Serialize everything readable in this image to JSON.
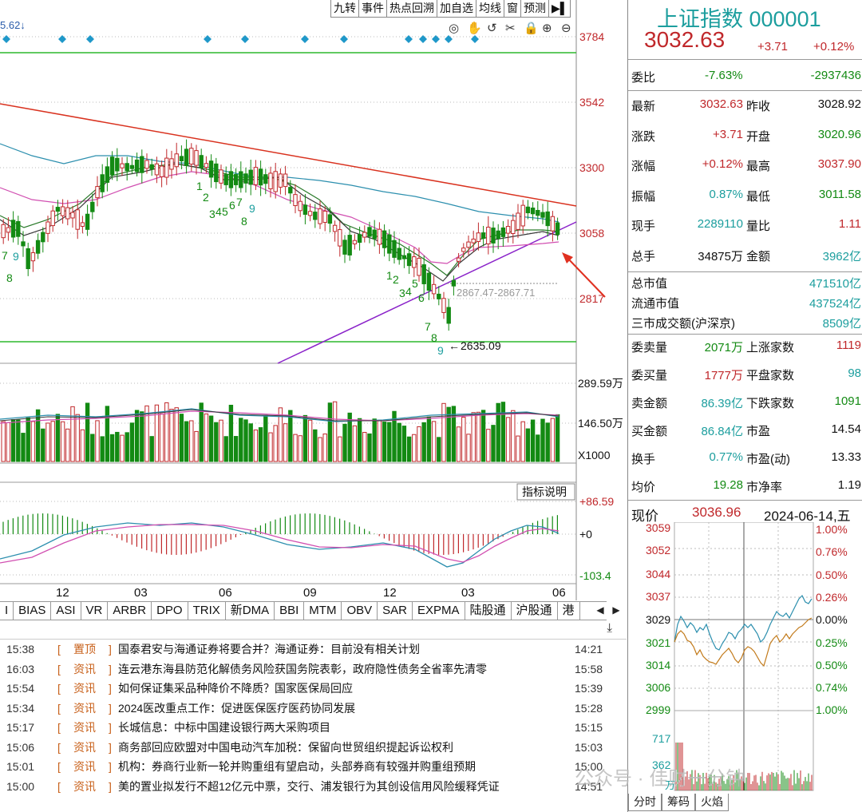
{
  "toolbar": {
    "buttons": [
      "九转",
      "事件",
      "热点回溯",
      "加自选",
      "均线",
      "窗",
      "预测"
    ],
    "arrow": "▶▌"
  },
  "top_value": "5.62↓",
  "price_axis": [
    "3784",
    "3542",
    "3300",
    "3058",
    "2817"
  ],
  "volume_axis": [
    "289.59万",
    "146.50万",
    "X1000"
  ],
  "macd_axis": [
    "+86.59",
    "+0",
    "-103.4"
  ],
  "indicator_help": "指标说明",
  "annotations": {
    "low_price": "2635.09",
    "gap_range": "2867.47-2867.71"
  },
  "time_axis": [
    "12",
    "03",
    "06",
    "09",
    "12",
    "03",
    "06"
  ],
  "indicator_tabs": [
    "I",
    "BIAS",
    "ASI",
    "VR",
    "ARBR",
    "DPO",
    "TRIX",
    "新DMA",
    "BBI",
    "MTM",
    "OBV",
    "SAR",
    "EXPMA",
    "陆股通",
    "沪股通",
    "港"
  ],
  "news": [
    {
      "time": "15:38",
      "tag": "置顶",
      "title": "国泰君安与海通证券将要合并？海通证券：目前没有相关计划",
      "time2": "14:21"
    },
    {
      "time": "16:03",
      "tag": "资讯",
      "title": "连云港东海县防范化解债务风险获国务院表彰，政府隐性债务全省率先清零",
      "time2": "15:58"
    },
    {
      "time": "15:54",
      "tag": "资讯",
      "title": "如何保证集采品种降价不降质？国家医保局回应",
      "time2": "15:39"
    },
    {
      "time": "15:34",
      "tag": "资讯",
      "title": "2024医改重点工作：促进医保医疗医药协同发展",
      "time2": "15:28"
    },
    {
      "time": "15:17",
      "tag": "资讯",
      "title": "长城信息：中标中国建设银行两大采购项目",
      "time2": "15:15"
    },
    {
      "time": "15:06",
      "tag": "资讯",
      "title": "商务部回应欧盟对中国电动汽车加税：保留向世贸组织提起诉讼权利",
      "time2": "15:03"
    },
    {
      "time": "15:01",
      "tag": "资讯",
      "title": "机构：券商行业新一轮并购重组有望启动，头部券商有较强并购重组预期",
      "time2": "15:00"
    },
    {
      "time": "15:00",
      "tag": "资讯",
      "title": "美的置业拟发行不超12亿元中票，交行、浦发银行为其创设信用风险缓释凭证",
      "time2": "14:51"
    }
  ],
  "quote": {
    "name": "上证指数 000001",
    "price": "3032.63",
    "change": "+3.71",
    "change_pct": "+0.12%",
    "weibi_label": "委比",
    "weibi_pct": "-7.63%",
    "weibi_val": "-2937436",
    "rows": [
      {
        "l1": "最新",
        "v1": "3032.63",
        "c1": "red",
        "l2": "昨收",
        "v2": "3028.92",
        "c2": "blk"
      },
      {
        "l1": "涨跌",
        "v1": "+3.71",
        "c1": "red",
        "l2": "开盘",
        "v2": "3020.96",
        "c2": "grn"
      },
      {
        "l1": "涨幅",
        "v1": "+0.12%",
        "c1": "red",
        "l2": "最高",
        "v2": "3037.90",
        "c2": "red"
      },
      {
        "l1": "振幅",
        "v1": "0.87%",
        "c1": "teal",
        "l2": "最低",
        "v2": "3011.58",
        "c2": "grn"
      },
      {
        "l1": "现手",
        "v1": "2289110",
        "c1": "teal",
        "l2": "量比",
        "v2": "1.11",
        "c2": "red"
      },
      {
        "l1": "总手",
        "v1": "34875万",
        "c1": "blk",
        "l2": "金额",
        "v2": "3962亿",
        "c2": "teal"
      }
    ],
    "market": [
      {
        "l": "总市值",
        "v": "471510亿"
      },
      {
        "l": "流通市值",
        "v": "437524亿"
      },
      {
        "l": "三市成交额(沪深京)",
        "v": "8509亿"
      }
    ],
    "orders": [
      {
        "l1": "委卖量",
        "v1": "2071万",
        "c1": "grn",
        "l2": "上涨家数",
        "v2": "1119",
        "c2": "red"
      },
      {
        "l1": "委买量",
        "v1": "1777万",
        "c1": "red",
        "l2": "平盘家数",
        "v2": "98",
        "c2": "teal"
      },
      {
        "l1": "卖金额",
        "v1": "86.39亿",
        "c1": "teal",
        "l2": "下跌家数",
        "v2": "1091",
        "c2": "grn"
      },
      {
        "l1": "买金额",
        "v1": "86.84亿",
        "c1": "teal",
        "l2": "市盈",
        "v2": "14.54",
        "c2": "blk"
      },
      {
        "l1": "换手",
        "v1": "0.77%",
        "c1": "teal",
        "l2": "市盈(动)",
        "v2": "13.33",
        "c2": "blk"
      },
      {
        "l1": "均价",
        "v1": "19.28",
        "c1": "grn",
        "l2": "市净率",
        "v2": "1.19",
        "c2": "blk"
      }
    ]
  },
  "mini": {
    "label": "现价",
    "price": "3036.96",
    "date": "2024-06-14,五",
    "left_axis": [
      "3059",
      "3052",
      "3044",
      "3037",
      "3029",
      "3021",
      "3014",
      "3006",
      "2999",
      "717",
      "362",
      "万"
    ],
    "right_axis": [
      "1.00%",
      "0.76%",
      "0.50%",
      "0.26%",
      "0.00%",
      "0.25%",
      "0.50%",
      "0.74%",
      "1.00%"
    ],
    "tabs": [
      "分时",
      "筹码",
      "火焰"
    ]
  },
  "watermark": "公众号 · 佳财一分钟"
}
